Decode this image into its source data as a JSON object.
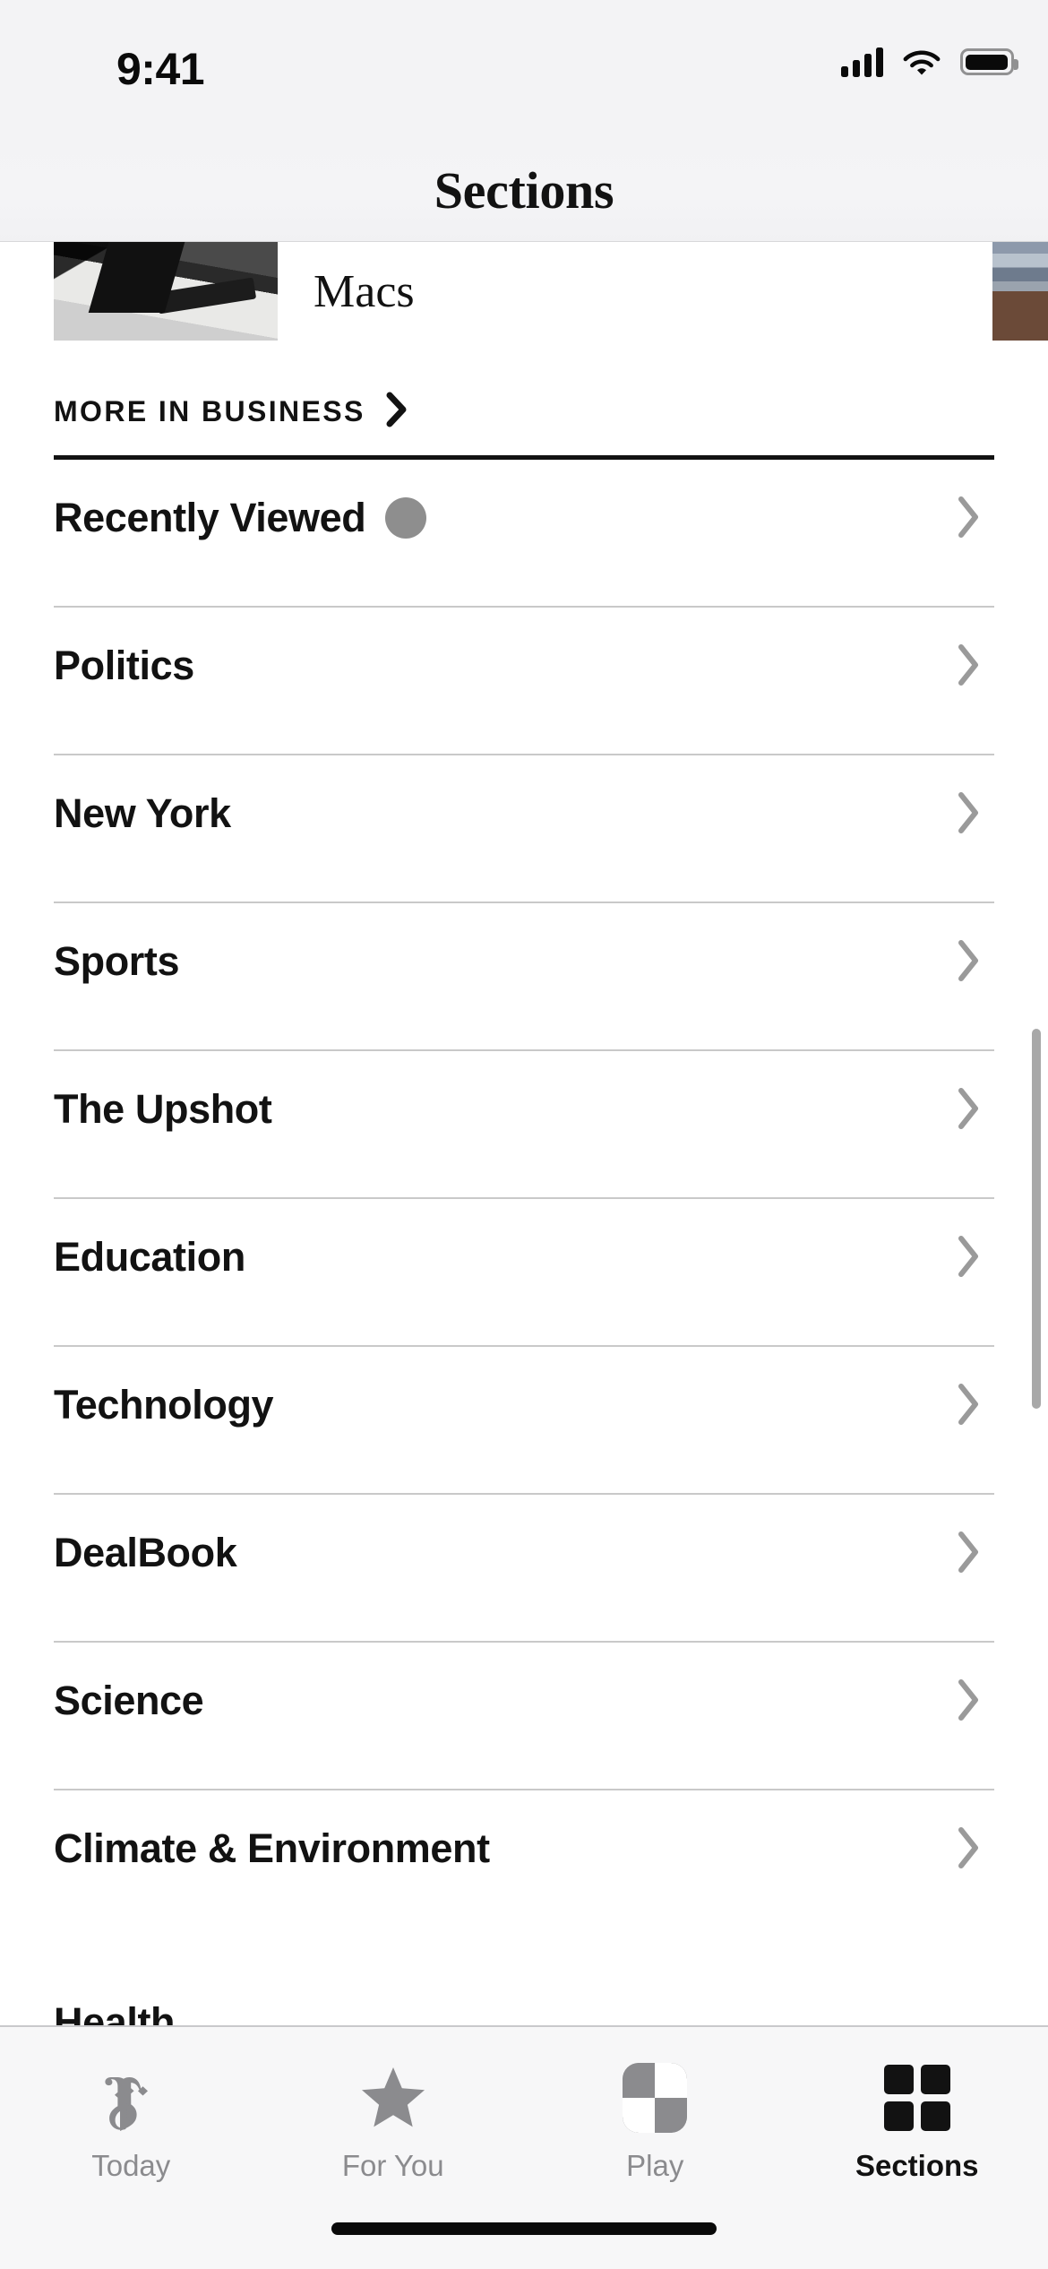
{
  "status_bar": {
    "time": "9:41",
    "cellular_icon": "cellular-signal-icon",
    "wifi_icon": "wifi-icon",
    "battery_icon": "battery-full-icon"
  },
  "nav": {
    "title": "Sections"
  },
  "carousel": {
    "visible_card_label": "Macs",
    "thumb_icon": "article-thumbnail",
    "next_card_icon": "article-thumbnail-partial"
  },
  "more_link": {
    "label": "MORE IN BUSINESS",
    "chevron_icon": "chevron-right-icon"
  },
  "sections": {
    "items": [
      {
        "label": "Recently Viewed",
        "badge": true,
        "chevron_icon": "chevron-right-icon"
      },
      {
        "label": "Politics",
        "badge": false,
        "chevron_icon": "chevron-right-icon"
      },
      {
        "label": "New York",
        "badge": false,
        "chevron_icon": "chevron-right-icon"
      },
      {
        "label": "Sports",
        "badge": false,
        "chevron_icon": "chevron-right-icon"
      },
      {
        "label": "The Upshot",
        "badge": false,
        "chevron_icon": "chevron-right-icon"
      },
      {
        "label": "Education",
        "badge": false,
        "chevron_icon": "chevron-right-icon"
      },
      {
        "label": "Technology",
        "badge": false,
        "chevron_icon": "chevron-right-icon"
      },
      {
        "label": "DealBook",
        "badge": false,
        "chevron_icon": "chevron-right-icon"
      },
      {
        "label": "Science",
        "badge": false,
        "chevron_icon": "chevron-right-icon"
      },
      {
        "label": "Climate & Environment",
        "badge": false,
        "chevron_icon": "chevron-right-icon"
      }
    ],
    "partial_next_label": "Health"
  },
  "scrollbar": {
    "icon": "vertical-scroll-indicator"
  },
  "tabbar": {
    "tabs": [
      {
        "label": "Today",
        "icon": "nyt-t-logo-icon",
        "active": false
      },
      {
        "label": "For You",
        "icon": "star-icon",
        "active": false
      },
      {
        "label": "Play",
        "icon": "play-checker-icon",
        "active": false
      },
      {
        "label": "Sections",
        "icon": "grid-2x2-icon",
        "active": true
      }
    ],
    "home_indicator_icon": "home-indicator"
  },
  "colors": {
    "text_primary": "#121212",
    "text_muted": "#8b8b8e",
    "chevron": "#9a9a9a",
    "divider": "#c9c9c9",
    "rule_thick": "#121212",
    "badge": "#8e8e8e",
    "chrome_bg": "#f3f3f5",
    "tabbar_bg": "#f7f7f8"
  }
}
